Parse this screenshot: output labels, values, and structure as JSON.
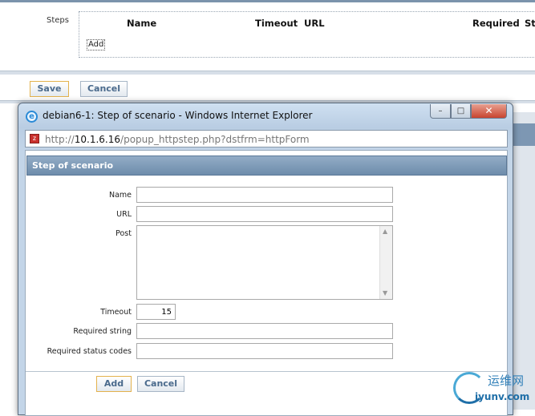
{
  "background": {
    "steps_label": "Steps",
    "columns": [
      "Name",
      "Timeout",
      "URL",
      "Required",
      "St"
    ],
    "add_link": "Add",
    "save_button": "Save",
    "cancel_button": "Cancel"
  },
  "window": {
    "title": "debian6-1: Step of scenario - Windows Internet Explorer",
    "address": {
      "prefix": "http://",
      "host": "10.1.6.16",
      "path": "/popup_httpstep.php?dstfrm=httpForm"
    },
    "controls": {
      "minimize": "–",
      "maximize": "□",
      "close": "✕"
    }
  },
  "form": {
    "header": "Step of scenario",
    "fields": {
      "name": {
        "label": "Name",
        "value": ""
      },
      "url": {
        "label": "URL",
        "value": ""
      },
      "post": {
        "label": "Post",
        "value": ""
      },
      "timeout": {
        "label": "Timeout",
        "value": "15"
      },
      "required_string": {
        "label": "Required string",
        "value": ""
      },
      "required_status_codes": {
        "label": "Required status codes",
        "value": ""
      }
    },
    "add_button": "Add",
    "cancel_button": "Cancel"
  },
  "watermark": {
    "cn": "运维网",
    "url": "iyunv.com"
  },
  "icons": {
    "ie": "internet-explorer-icon",
    "page": "page-icon"
  }
}
